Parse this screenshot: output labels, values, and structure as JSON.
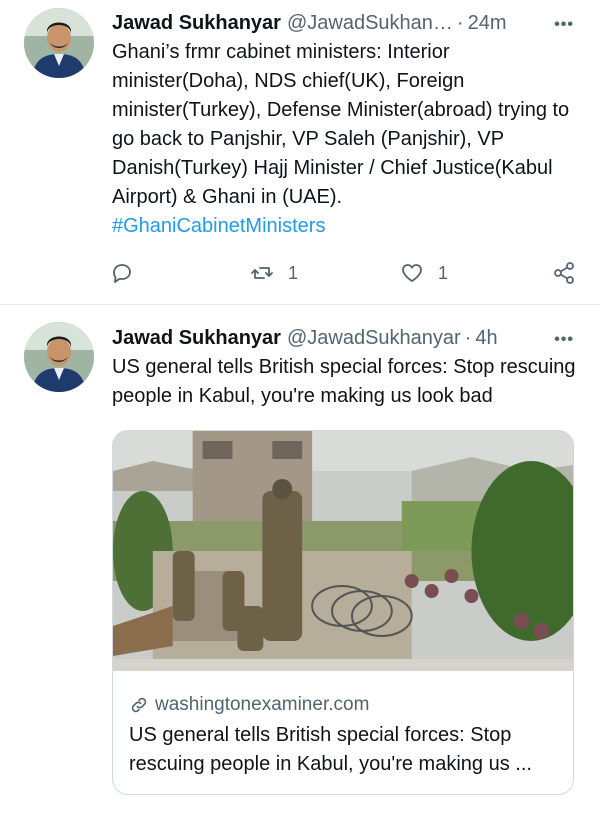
{
  "tweets": [
    {
      "author_name": "Jawad Sukhanyar",
      "author_handle": "@JawadSukhan…",
      "separator": "·",
      "time": "24m",
      "more_label": "•••",
      "text": "Ghani’s frmr cabinet ministers: Interior minister(Doha), NDS chief(UK), Foreign minister(Turkey), Defense Minister(abroad) trying to go back to Panjshir, VP Saleh (Panjshir), VP Danish(Turkey) Hajj Minister / Chief Justice(Kabul Airport) & Ghani in (UAE).",
      "hashtag": "#GhaniCabinetMinisters",
      "actions": {
        "reply_icon": "reply-icon",
        "retweet_icon": "retweet-icon",
        "retweet_count": "1",
        "like_icon": "heart-icon",
        "like_count": "1",
        "share_icon": "share-icon"
      }
    },
    {
      "author_name": "Jawad Sukhanyar",
      "author_handle": "@JawadSukhanyar",
      "separator": "·",
      "time": "4h",
      "more_label": "•••",
      "text": "US general tells British special forces: Stop rescuing people in Kabul, you're making us look bad",
      "card": {
        "image_description_icon": "photo",
        "link_icon": "link-icon",
        "domain": "washingtonexaminer.com",
        "title": "US general tells British special forces: Stop rescuing people in Kabul, you're making us ..."
      }
    }
  ],
  "colors": {
    "accent": "#1d9bf0",
    "text": "#0f1419",
    "secondary": "#536471",
    "divider": "#e7eaee"
  }
}
